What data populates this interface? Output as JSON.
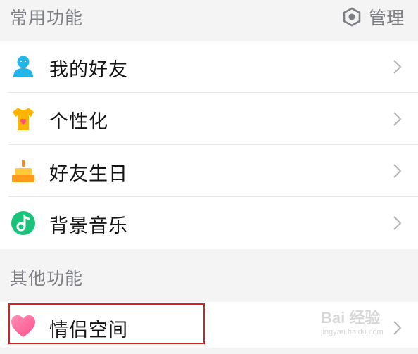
{
  "sections": {
    "common": {
      "title": "常用功能",
      "manage_label": "管理"
    },
    "other": {
      "title": "其他功能"
    }
  },
  "common_items": [
    {
      "label": "我的好友",
      "icon": "friend-avatar-icon"
    },
    {
      "label": "个性化",
      "icon": "tshirt-heart-icon"
    },
    {
      "label": "好友生日",
      "icon": "birthday-cake-icon"
    },
    {
      "label": "背景音乐",
      "icon": "music-note-icon"
    }
  ],
  "other_items": [
    {
      "label": "情侣空间",
      "icon": "heart-icon"
    }
  ],
  "watermark": {
    "main": "Bai 经验",
    "sub": "jingyan.baidu.com"
  },
  "colors": {
    "highlight_border": "#d02424",
    "section_text": "#7f8085"
  }
}
